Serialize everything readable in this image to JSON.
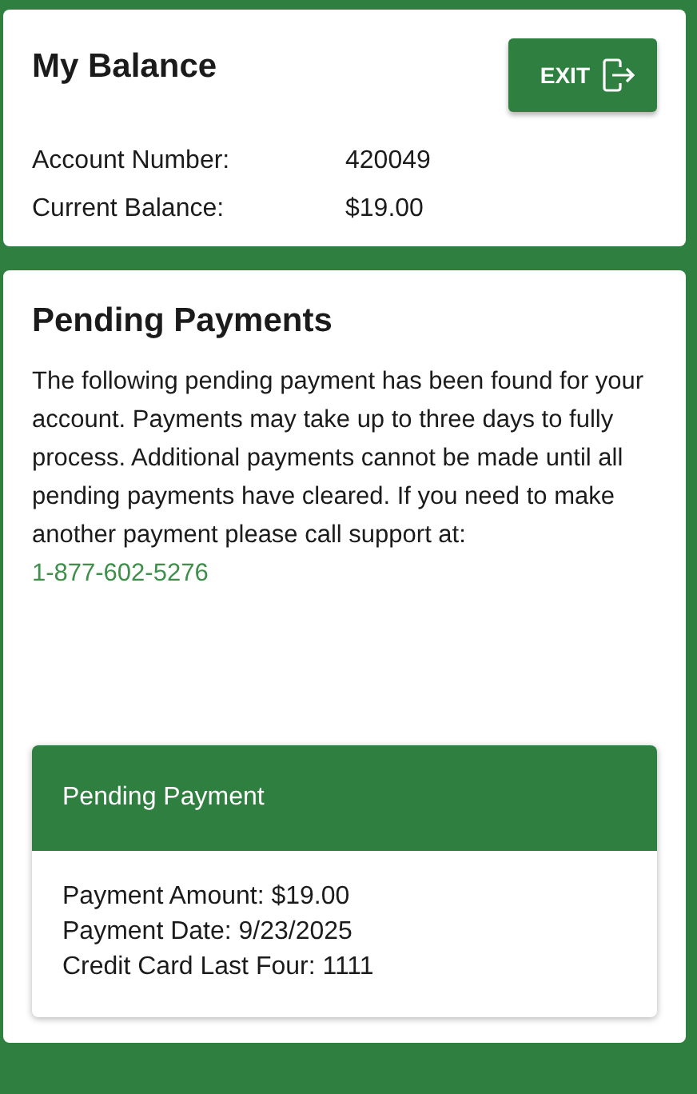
{
  "balance": {
    "title": "My Balance",
    "exit_button": "EXIT",
    "fields": [
      {
        "label": "Account Number:",
        "value": "420049"
      },
      {
        "label": "Current Balance:",
        "value": "$19.00"
      }
    ]
  },
  "pending": {
    "title": "Pending Payments",
    "message": "The following pending payment has been found for your account. Payments may take up to three days to fully process. Additional payments cannot be made until all pending payments have cleared. If you need to make another payment please call support at:",
    "phone": "1-877-602-5276",
    "payment": {
      "header": "Pending Payment",
      "lines": [
        "Payment Amount: $19.00",
        "Payment Date: 9/23/2025",
        "Credit Card Last Four: 1111"
      ]
    }
  }
}
